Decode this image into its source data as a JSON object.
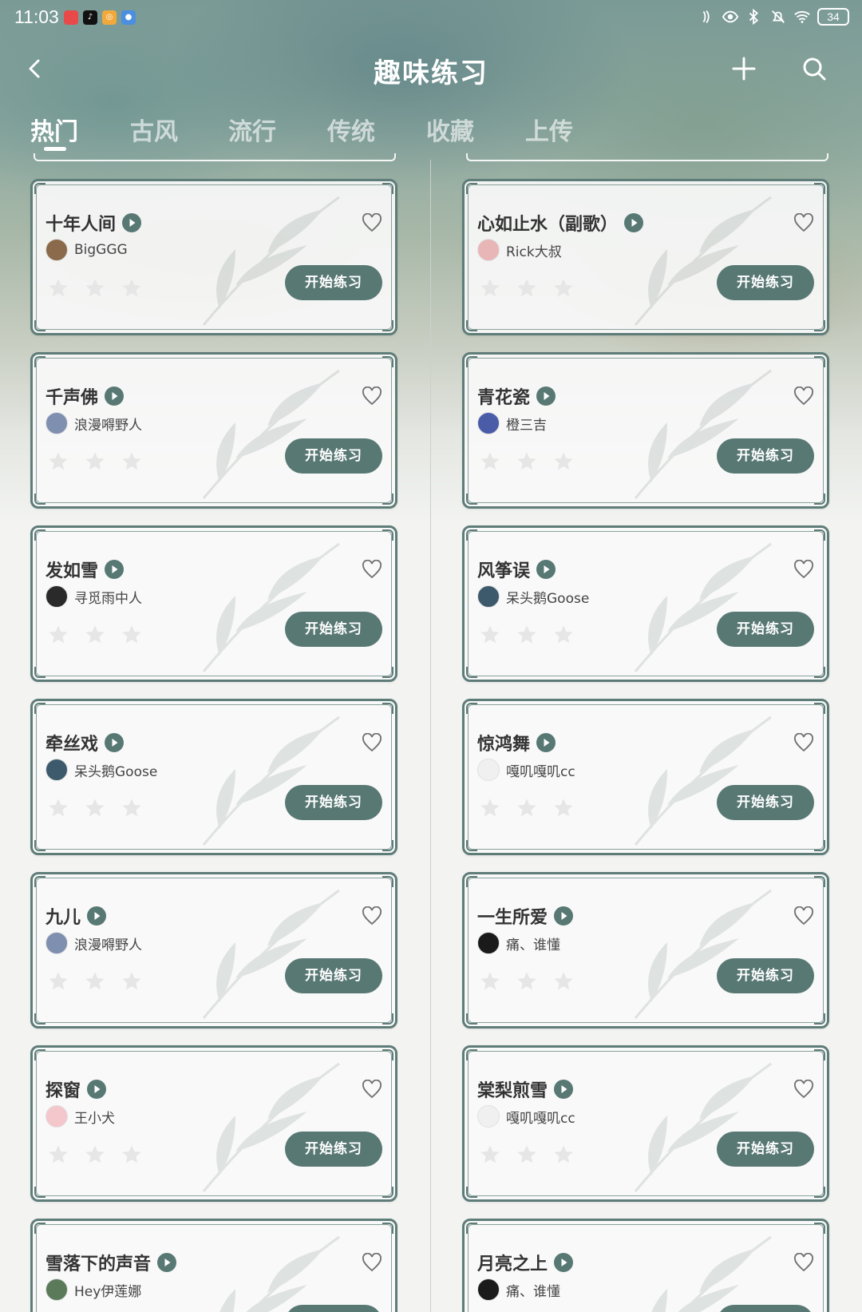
{
  "status_bar": {
    "time": "11:03",
    "app_icons": [
      "notification-app-icon",
      "tiktok-icon",
      "weibo-icon",
      "browser-icon"
    ],
    "battery": "34"
  },
  "header": {
    "title": "趣味练习"
  },
  "tabs": [
    {
      "label": "热门",
      "active": true
    },
    {
      "label": "古风",
      "active": false
    },
    {
      "label": "流行",
      "active": false
    },
    {
      "label": "传统",
      "active": false
    },
    {
      "label": "收藏",
      "active": false
    },
    {
      "label": "上传",
      "active": false
    }
  ],
  "button_label": "开始练习",
  "colors": {
    "accent": "#587874",
    "card_border": "#5e7c78",
    "star": "#e6e6e6"
  },
  "songs": [
    {
      "title": "十年人间",
      "author": "BigGGG",
      "stars": 0,
      "avatar_color": "#8a6a4a"
    },
    {
      "title": "心如止水（副歌）",
      "author": "Rick大叔",
      "stars": 0,
      "avatar_color": "#e8b6b6"
    },
    {
      "title": "千声佛",
      "author": "浪漫嘚野人",
      "stars": 0,
      "avatar_color": "#7e8fb0"
    },
    {
      "title": "青花瓷",
      "author": "橙三吉",
      "stars": 0,
      "avatar_color": "#4a5ca8"
    },
    {
      "title": "发如雪",
      "author": "寻觅雨中人",
      "stars": 0,
      "avatar_color": "#2a2a2a"
    },
    {
      "title": "风筝误",
      "author": "呆头鹅Goose",
      "stars": 0,
      "avatar_color": "#3d5a6c"
    },
    {
      "title": "牵丝戏",
      "author": "呆头鹅Goose",
      "stars": 0,
      "avatar_color": "#3d5a6c"
    },
    {
      "title": "惊鸿舞",
      "author": "嘎叽嘎叽cc",
      "stars": 0,
      "avatar_color": "#f0f0f0"
    },
    {
      "title": "九儿",
      "author": "浪漫嘚野人",
      "stars": 0,
      "avatar_color": "#7e8fb0"
    },
    {
      "title": "一生所爱",
      "author": "痛、谁懂",
      "stars": 0,
      "avatar_color": "#1a1a1a"
    },
    {
      "title": "探窗",
      "author": "王小犬",
      "stars": 0,
      "avatar_color": "#f4c7cc"
    },
    {
      "title": "棠梨煎雪",
      "author": "嘎叽嘎叽cc",
      "stars": 0,
      "avatar_color": "#f0f0f0"
    },
    {
      "title": "雪落下的声音",
      "author": "Hey伊莲娜",
      "stars": 0,
      "avatar_color": "#5a7a5a"
    },
    {
      "title": "月亮之上",
      "author": "痛、谁懂",
      "stars": 0,
      "avatar_color": "#1a1a1a"
    }
  ]
}
